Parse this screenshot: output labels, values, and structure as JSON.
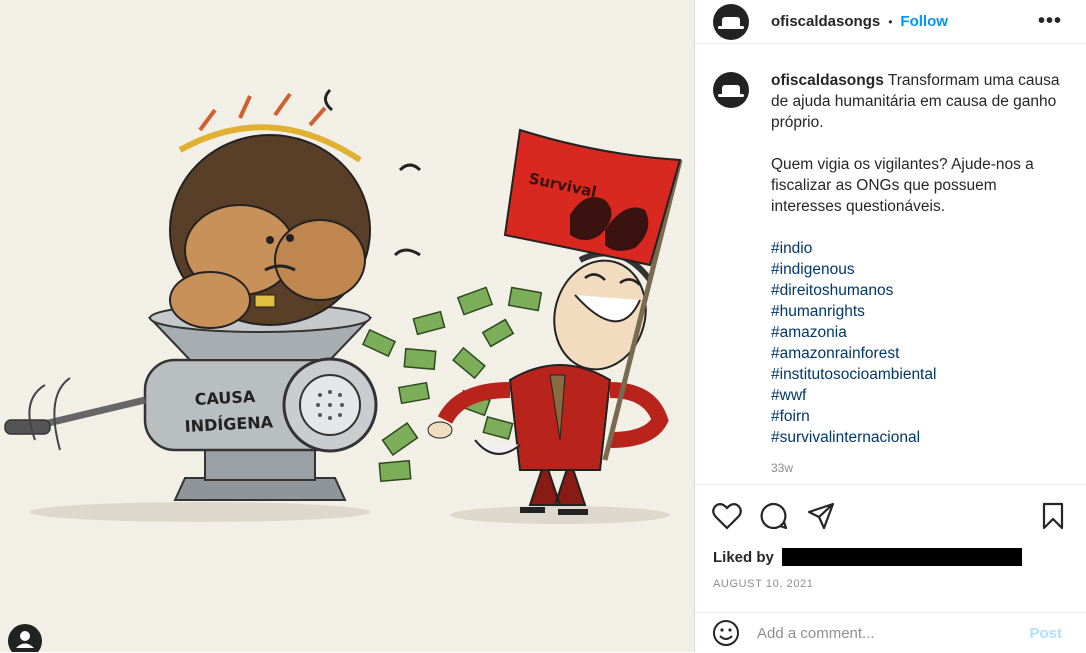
{
  "post": {
    "username": "ofiscaldasongs",
    "follow_label": "Follow",
    "more_label": "•••",
    "image_texts": {
      "flag_text": "Survival",
      "grinder_text": "CAUSA INDÍGENA"
    }
  },
  "caption": {
    "username": "ofiscaldasongs",
    "paragraph1": "Transformam uma causa de ajuda humanitária em causa de ganho próprio.",
    "paragraph2": "Quem vigia os vigilantes? Ajude-nos a fiscalizar as ONGs que possuem interesses questionáveis.",
    "hashtags": [
      "#indio",
      "#indigenous",
      "#direitoshumanos",
      "#humanrights",
      "#amazonia",
      "#amazonrainforest",
      "#institutosocioambiental",
      "#wwf",
      "#foirn",
      "#survivalinternacional"
    ],
    "time_ago": "33w"
  },
  "actions": {
    "like_icon": "heart-icon",
    "comment_icon": "comment-icon",
    "share_icon": "send-icon",
    "save_icon": "bookmark-icon"
  },
  "likes": {
    "label": "Liked by"
  },
  "date": "AUGUST 10, 2021",
  "comment": {
    "placeholder": "Add a comment...",
    "emoji_icon": "smiley-icon",
    "post_label": "Post"
  },
  "colors": {
    "flag_red": "#d8281f",
    "link_blue": "#0095f6",
    "hashtag_blue": "#00376b",
    "suit_red": "#b8231c"
  }
}
